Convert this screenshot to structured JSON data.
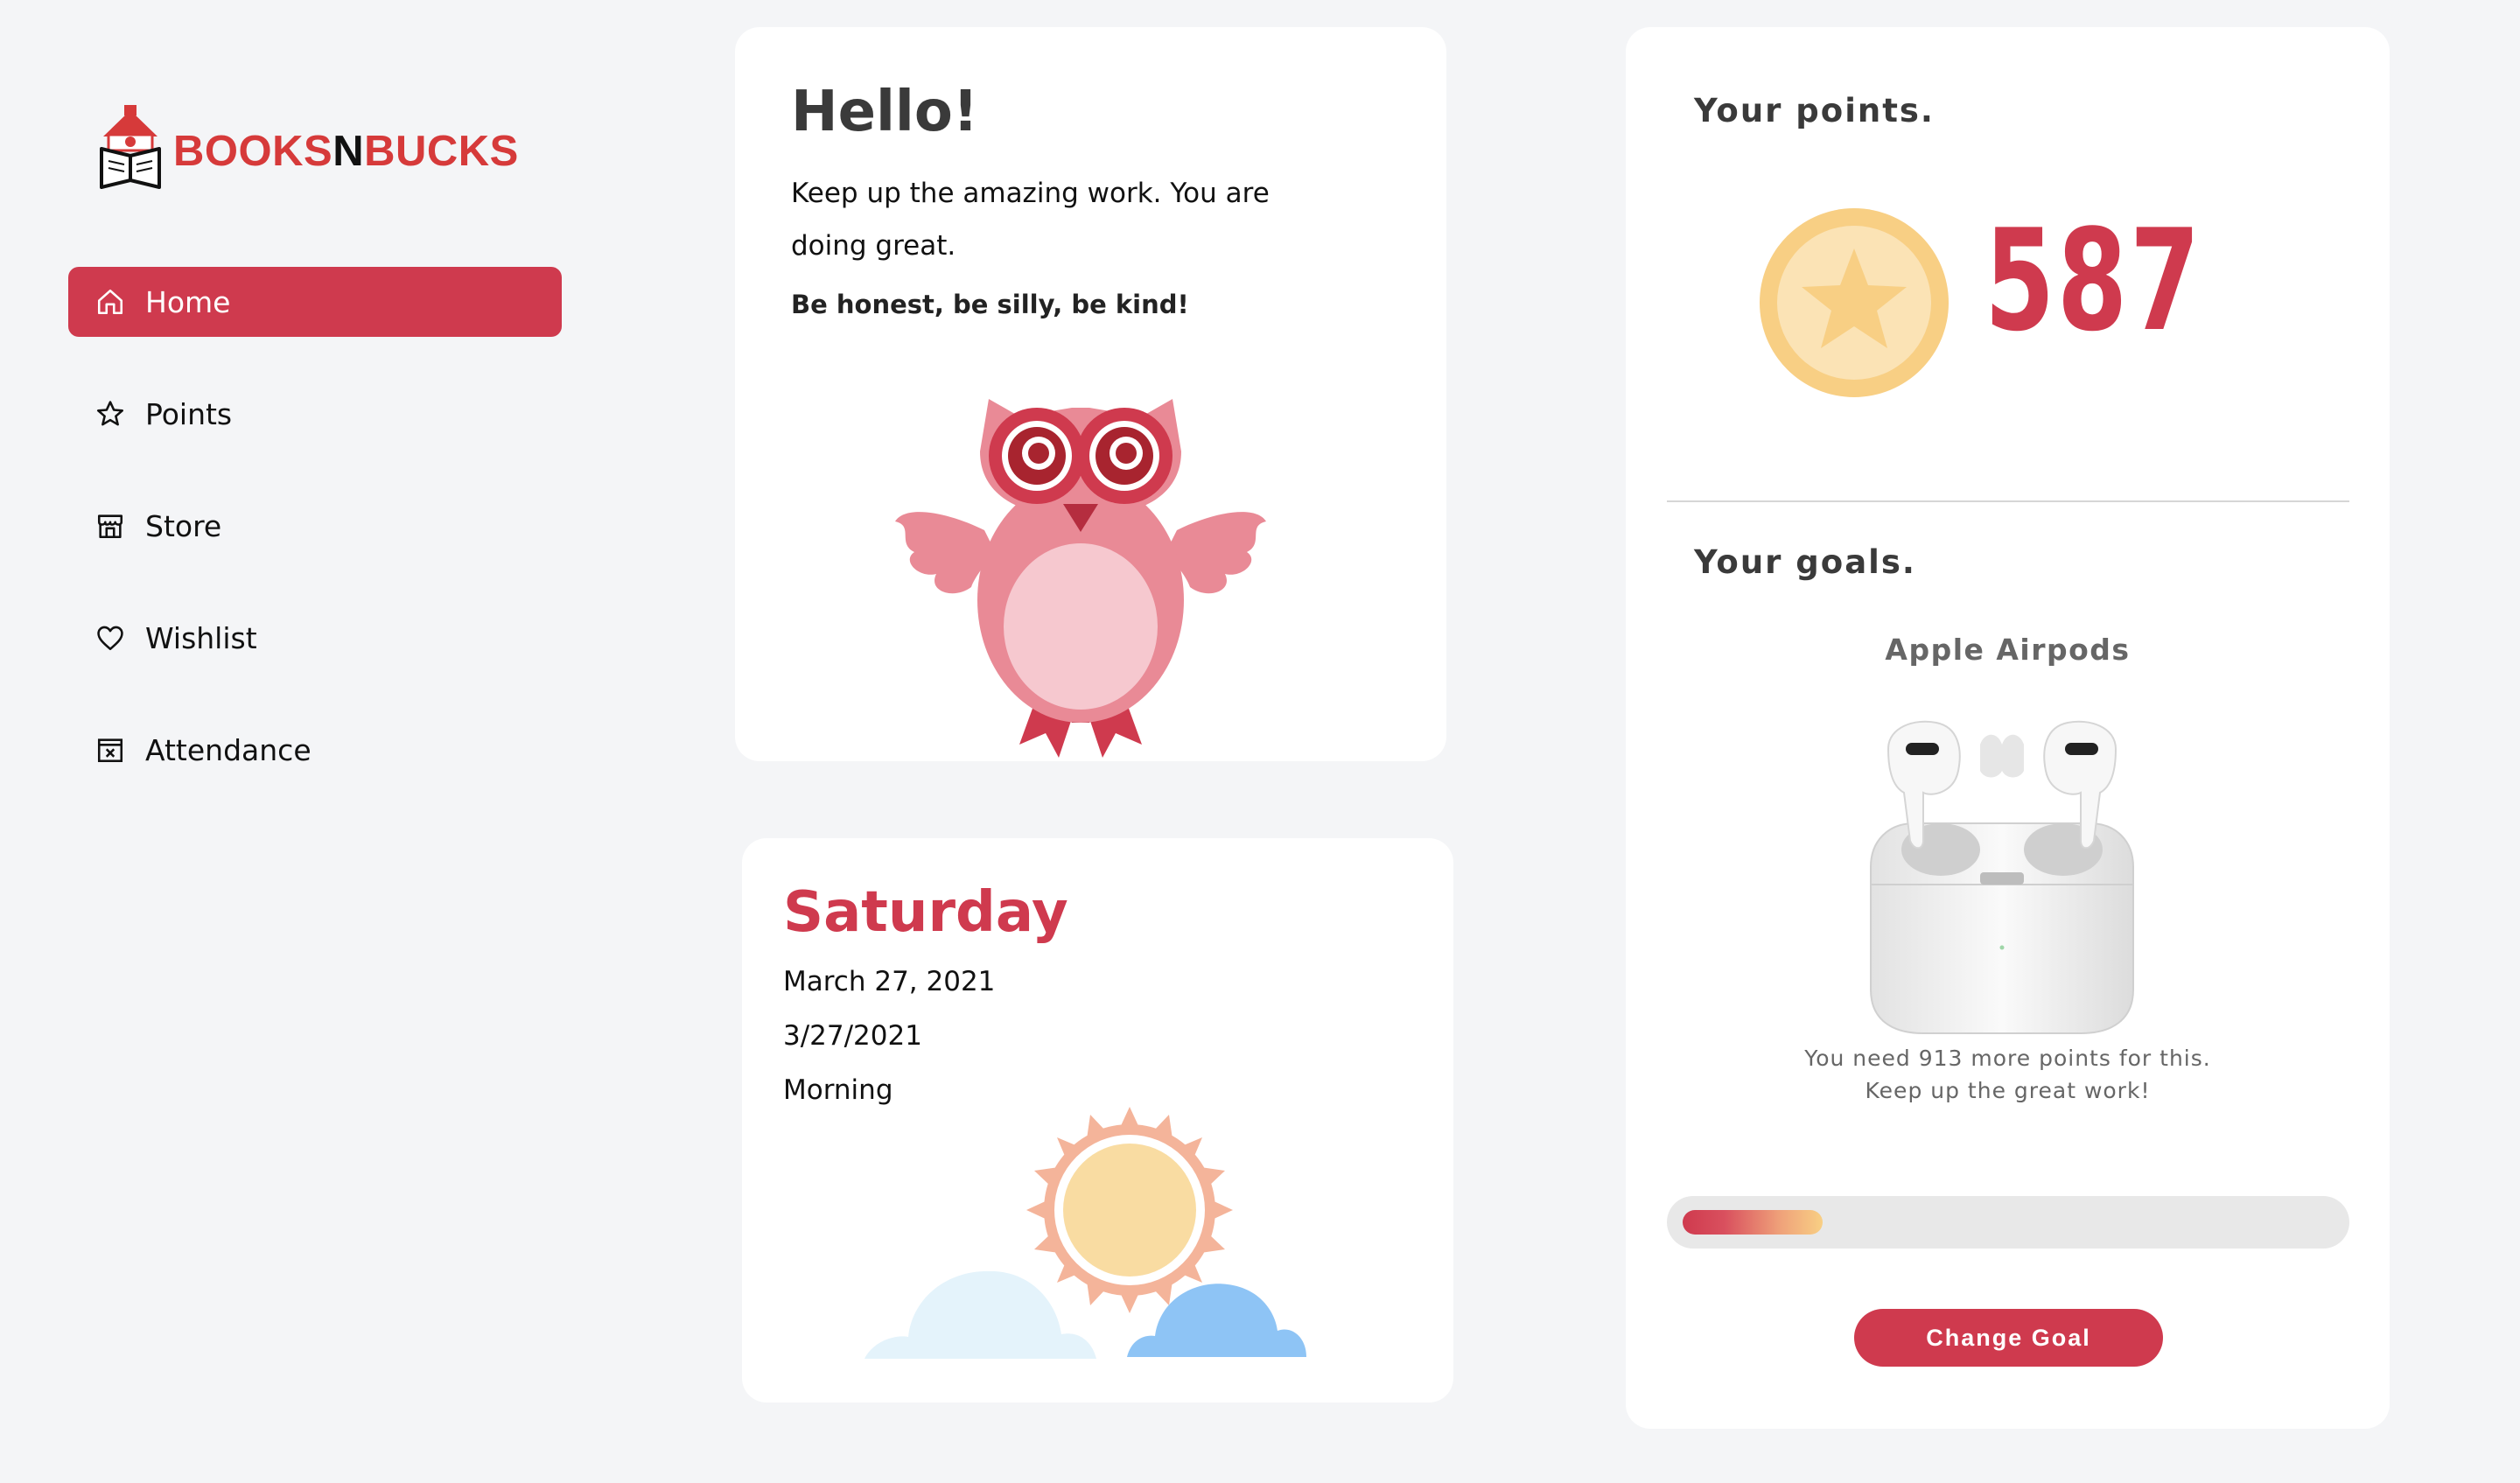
{
  "brand": {
    "part1": "BOOKS",
    "part2": "N",
    "part3": "BUCKS"
  },
  "sidebar": {
    "items": [
      {
        "label": "Home",
        "icon": "home-icon",
        "active": true
      },
      {
        "label": "Points",
        "icon": "star-icon",
        "active": false
      },
      {
        "label": "Store",
        "icon": "store-icon",
        "active": false
      },
      {
        "label": "Wishlist",
        "icon": "heart-icon",
        "active": false
      },
      {
        "label": "Attendance",
        "icon": "calendar-icon",
        "active": false
      }
    ]
  },
  "hello": {
    "title": "Hello!",
    "message": "Keep up the amazing work. You are doing great.",
    "motto": "Be honest, be silly, be kind!"
  },
  "date": {
    "day": "Saturday",
    "long": "March 27, 2021",
    "short": "3/27/2021",
    "period": "Morning"
  },
  "points": {
    "title": "Your points.",
    "value": "587"
  },
  "goals": {
    "title": "Your goals.",
    "name": "Apple Airpods",
    "need_line1": "You need 913 more points for this.",
    "need_line2": "Keep up the great work!",
    "progress": 0.21,
    "button": "Change Goal"
  },
  "colors": {
    "accent": "#cf3a4e",
    "coin": "#f8cf84",
    "background": "#f4f5f7"
  }
}
